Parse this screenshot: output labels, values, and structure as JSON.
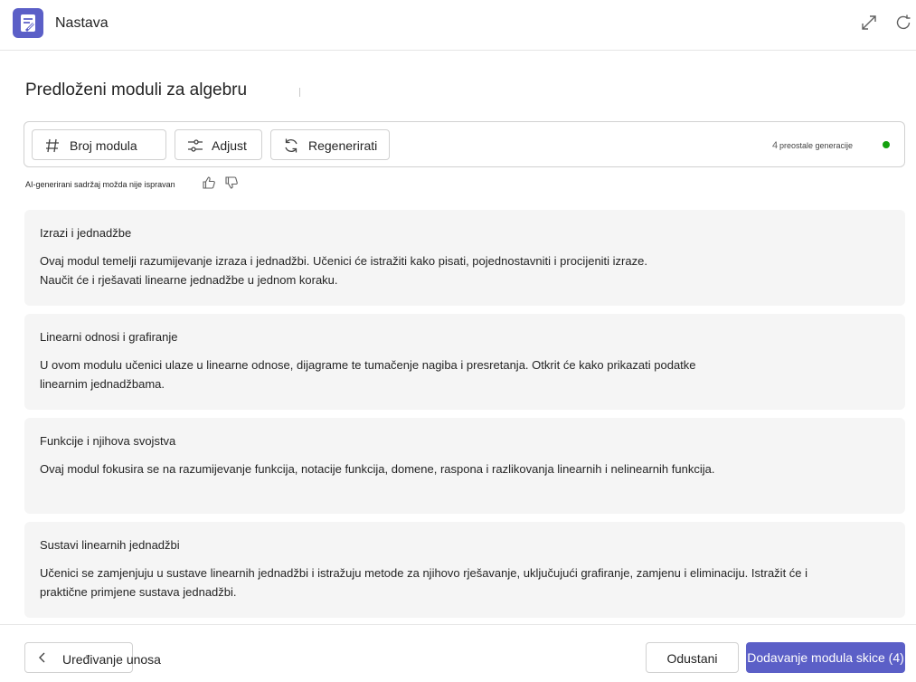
{
  "app": {
    "title": "Nastava",
    "icon": "app-icon"
  },
  "header": {
    "expand_icon": "expand-icon",
    "refresh_icon": "refresh-icon"
  },
  "page": {
    "title": "Predloženi moduli za algebru"
  },
  "toolbar": {
    "module_count_label": "Broj modula",
    "adjust_label": "Adjust",
    "regenerate_label": "Regenerirati",
    "generations_count": "4",
    "generations_label": "preostale generacije",
    "status_color": "#13a10e"
  },
  "disclaimer": {
    "text": "AI-generirani sadržaj možda nije ispravan"
  },
  "modules": [
    {
      "title": "Izrazi i jednadžbe",
      "description": "Ovaj modul temelji razumijevanje izraza i jednadžbi. Učenici će istražiti kako pisati, pojednostavniti i procijeniti izraze. Naučit će i rješavati linearne jednadžbe u jednom koraku."
    },
    {
      "title": "Linearni odnosi i grafiranje",
      "description": "U ovom modulu učenici ulaze u linearne odnose, dijagrame te tumačenje nagiba i presretanja. Otkrit će kako prikazati podatke linearnim jednadžbama."
    },
    {
      "title": "Funkcije i njihova svojstva",
      "description": "Ovaj modul fokusira se na razumijevanje funkcija, notacije funkcija, domene, raspona i razlikovanja linearnih i nelinearnih funkcija."
    },
    {
      "title": "Sustavi linearnih jednadžbi",
      "description": "Učenici se zamjenjuju u sustave linearnih jednadžbi i istražuju metode za njihovo rješavanje, uključujući grafiranje, zamjenu i eliminaciju. Istražit će i praktične primjene sustava jednadžbi."
    }
  ],
  "footer": {
    "back_label": "Uređivanje unosa",
    "cancel_label": "Odustani",
    "add_label": "Dodavanje modula skice (4)"
  },
  "colors": {
    "accent": "#5b5fc7",
    "card_bg": "#f5f5f5"
  }
}
